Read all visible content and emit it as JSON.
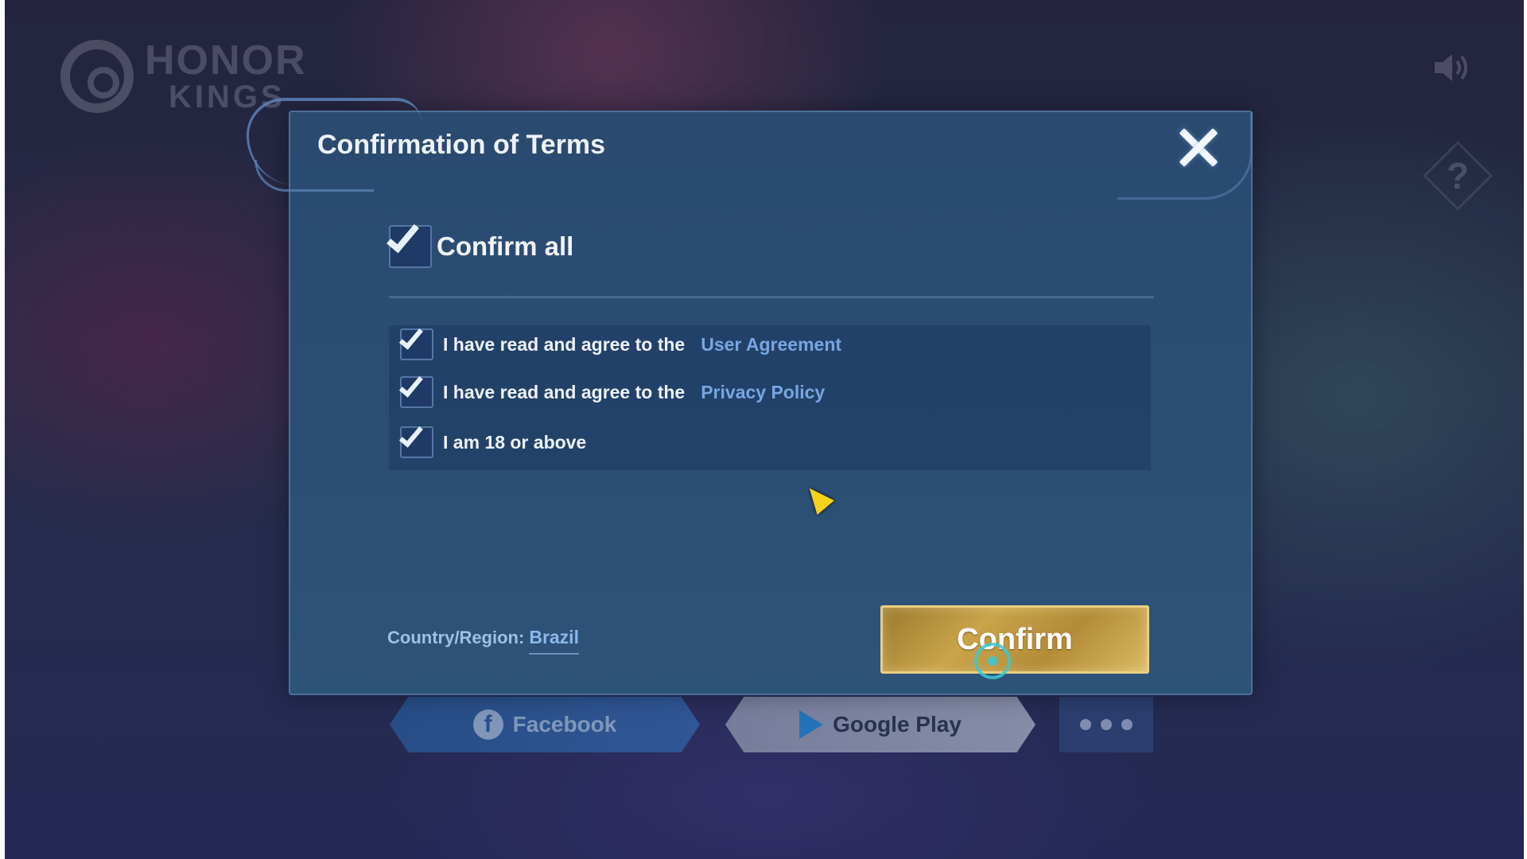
{
  "brand": {
    "line1": "HONOR",
    "line2": "KINGS"
  },
  "corner": {
    "sound_icon": "speaker-icon",
    "help_label": "?"
  },
  "login": {
    "facebook_label": "Facebook",
    "google_play_label": "Google Play"
  },
  "dialog": {
    "title": "Confirmation of Terms",
    "confirm_all": {
      "label": "Confirm all",
      "checked": true
    },
    "terms": [
      {
        "prefix": "I have read and agree to the",
        "link": "User Agreement",
        "checked": true
      },
      {
        "prefix": "I have read and agree to the",
        "link": "Privacy Policy",
        "checked": true
      },
      {
        "prefix": "I am 18 or above",
        "link": "",
        "checked": true
      }
    ],
    "region_label": "Country/Region:",
    "region_value": "Brazil",
    "confirm_button": "Confirm"
  },
  "colors": {
    "dialog_bg": "#2c4e75",
    "link": "#77a6e2",
    "confirm_gold": "#c9a44b"
  }
}
